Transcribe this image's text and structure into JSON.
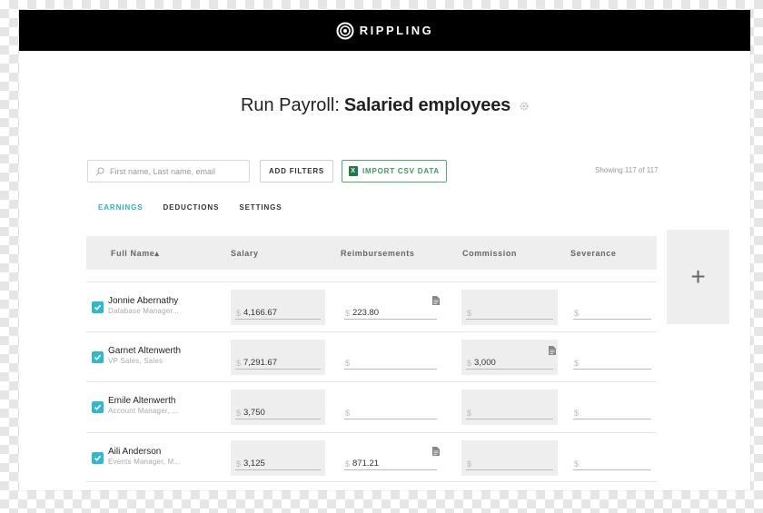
{
  "header": {
    "brand": "RIPPLING"
  },
  "page": {
    "title_prefix": "Run Payroll:",
    "title_main": "Salaried employees"
  },
  "toolbar": {
    "search_placeholder": "First name, Last name, email",
    "add_filters_label": "ADD FILTERS",
    "import_csv_label": "IMPORT CSV DATA",
    "showing_text": "Showing 117 of 117"
  },
  "tabs": [
    {
      "label": "EARNINGS",
      "active": true
    },
    {
      "label": "DEDUCTIONS",
      "active": false
    },
    {
      "label": "SETTINGS",
      "active": false
    }
  ],
  "table": {
    "columns": [
      "Full Name▴",
      "Salary",
      "Reimbursements",
      "Commission",
      "Severance"
    ],
    "currency": "$",
    "rows": [
      {
        "name": "Jonnie Abernathy",
        "role": "Database Manager...",
        "salary": "4,166.67",
        "reimbursements": "223.80",
        "commission": "",
        "severance": ""
      },
      {
        "name": "Garnet Altenwerth",
        "role": "VP Sales, Sales",
        "salary": "7,291.67",
        "reimbursements": "",
        "commission": "3,000",
        "severance": ""
      },
      {
        "name": "Emile Altenwerth",
        "role": "Account Manager, ...",
        "salary": "3,750",
        "reimbursements": "",
        "commission": "",
        "severance": ""
      },
      {
        "name": "Aili Anderson",
        "role": "Events Manager, M...",
        "salary": "3,125",
        "reimbursements": "871.21",
        "commission": "",
        "severance": ""
      }
    ]
  },
  "add_column_label": "+",
  "colors": {
    "accent": "#26b5cc",
    "checkbox": "#2fb8d0",
    "import_green": "#3c9a58",
    "topbar": "#000000"
  }
}
